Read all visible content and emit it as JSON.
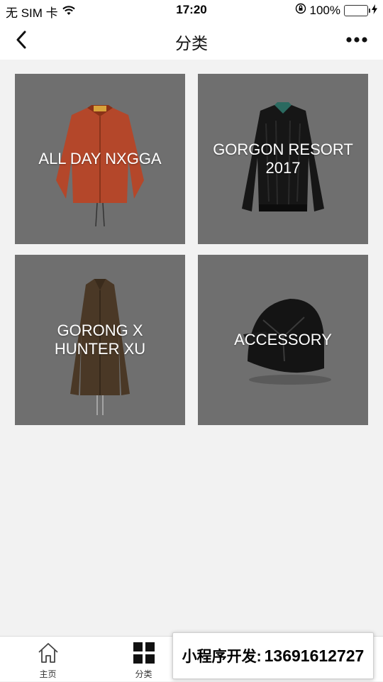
{
  "status_bar": {
    "carrier": "无 SIM 卡",
    "time": "17:20",
    "battery": "100%",
    "icons": [
      "wifi-icon",
      "orientation-lock-icon",
      "battery-icon",
      "charging-icon"
    ]
  },
  "nav": {
    "title": "分类",
    "back_icon": "chevron-left-icon",
    "more_icon": "more-dots-icon"
  },
  "categories": [
    {
      "label": "ALL DAY NXGGA",
      "image": "orange-coach-jacket"
    },
    {
      "label": "GORGON RESORT\n2017",
      "image": "black-velvet-bomber-jacket"
    },
    {
      "label": "GORONG X\nHUNTER XU",
      "image": "brown-long-coat"
    },
    {
      "label": "ACCESSORY",
      "image": "black-cap"
    }
  ],
  "tab_bar": {
    "tabs": [
      {
        "label": "主页",
        "icon": "home-icon"
      },
      {
        "label": "分类",
        "icon": "grid-icon"
      }
    ]
  },
  "watermark": {
    "text": "小程序开发:",
    "phone": "13691612727"
  },
  "colors": {
    "card_bg": "#6f6f6f",
    "page_bg": "#f2f2f2",
    "battery_green": "#4cd964"
  }
}
